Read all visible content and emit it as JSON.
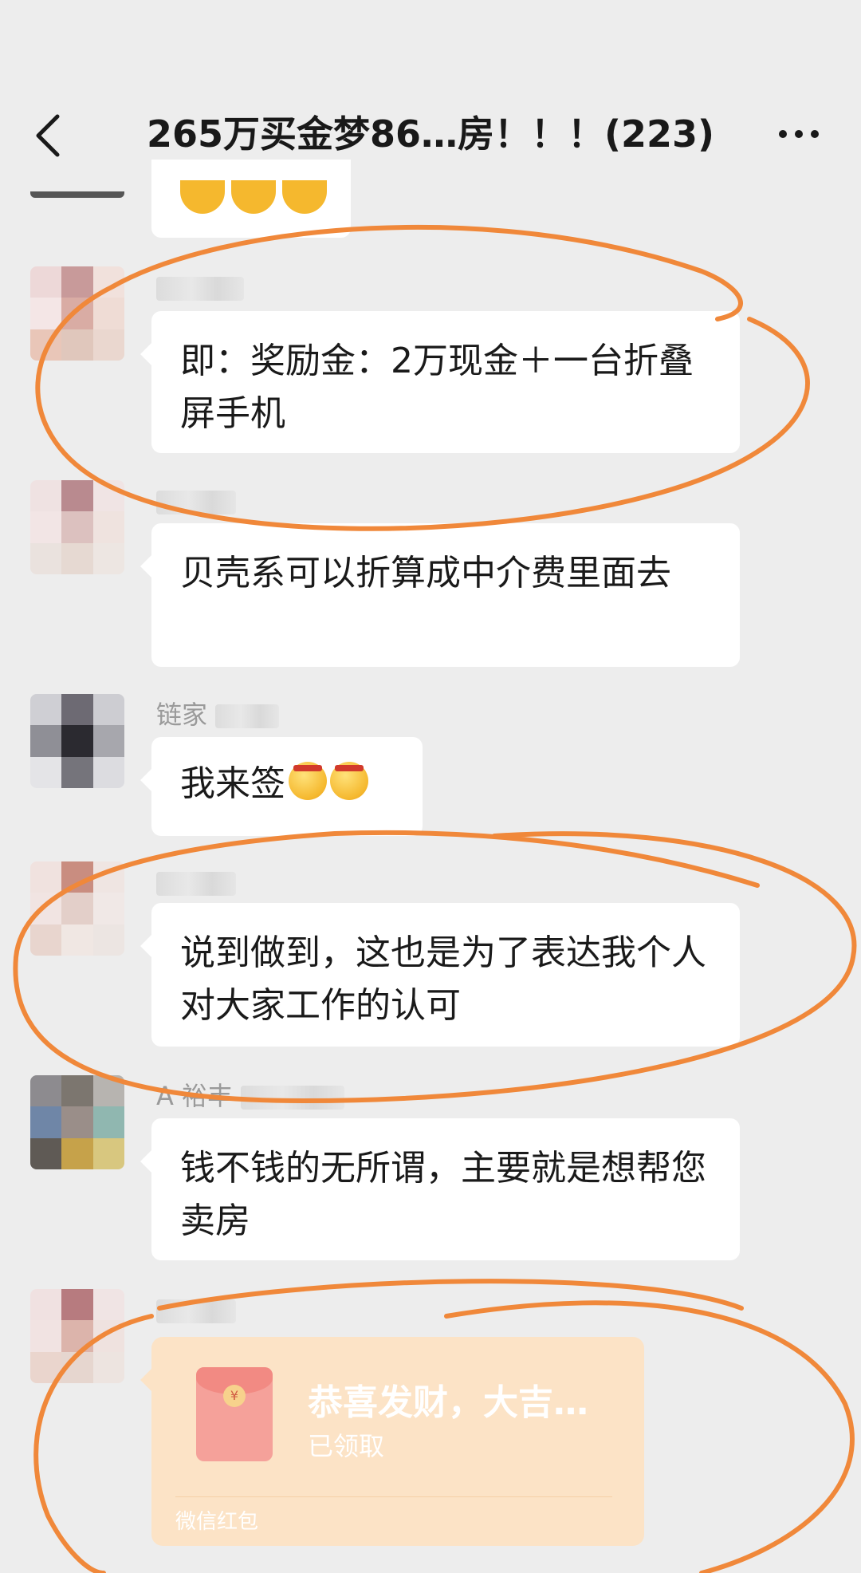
{
  "header": {
    "title": "265万买金梦86…房！！！(223)",
    "back_icon": "back-arrow-icon",
    "more_icon": "more-dots-icon"
  },
  "messages": [
    {
      "text": "即：奖励金：2万现金＋一台折叠屏手机"
    },
    {
      "text": "贝壳系可以折算成中介费里面去"
    },
    {
      "sender": "链家",
      "text": "我来签"
    },
    {
      "text": "说到做到，这也是为了表达我个人对大家工作的认可"
    },
    {
      "sender": "A 裕丰",
      "text": "钱不钱的无所谓，主要就是想帮您卖房"
    },
    {
      "red_packet": {
        "title": "恭喜发财，大吉…",
        "status": "已领取",
        "label": "微信红包"
      }
    }
  ],
  "colors": {
    "annotation": "#f0883a",
    "background": "#ededed",
    "bubble": "#ffffff",
    "red_packet": "#fce3c6"
  }
}
